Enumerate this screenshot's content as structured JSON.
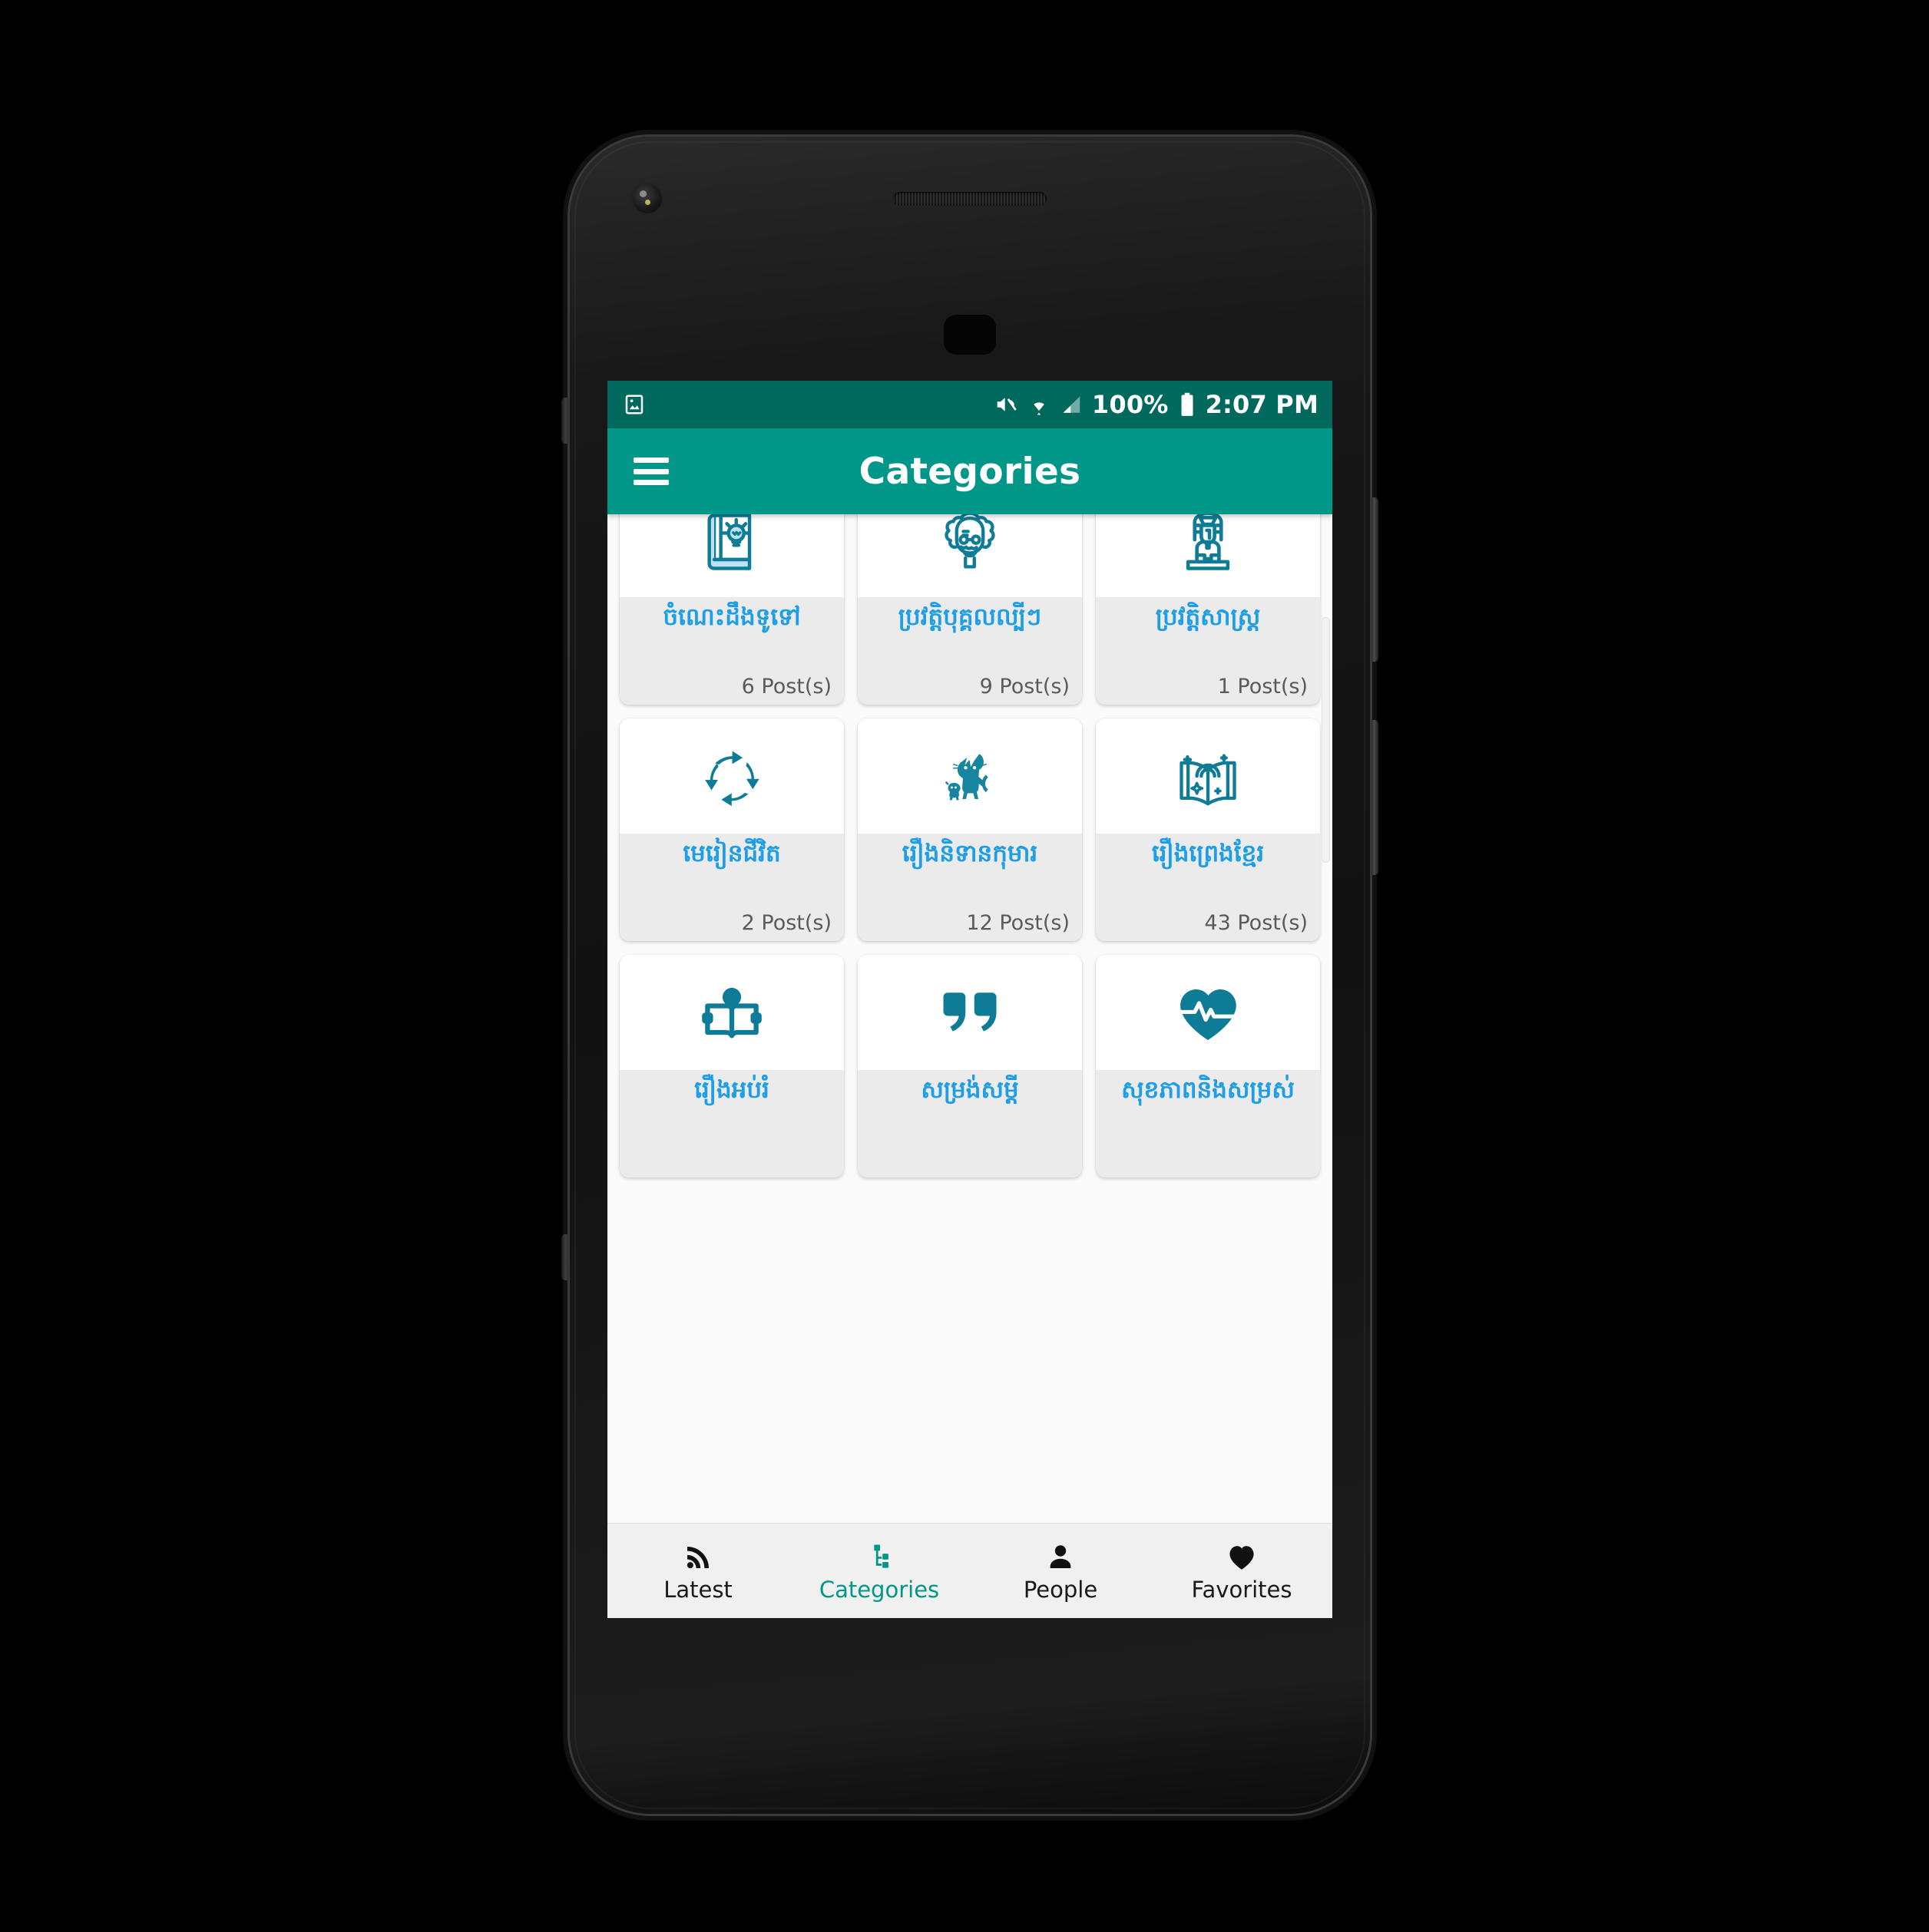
{
  "status_bar": {
    "notification_icon": "image-icon",
    "mute_icon": "volume-mute-icon",
    "wifi_icon": "wifi-icon",
    "signal_icon": "cell-signal-icon",
    "battery_percent": "100%",
    "battery_icon": "battery-full-icon",
    "time": "2:07 PM",
    "background_color": "#00695e"
  },
  "app_bar": {
    "menu_icon": "hamburger-menu-icon",
    "title": "Categories",
    "background_color": "#009688",
    "text_color": "#ffffff"
  },
  "grid": {
    "columns": 3,
    "accent_title_color": "#1e9ee6",
    "icon_color": "#0e7c96",
    "card_body_color": "#ebebeb",
    "cards": [
      {
        "icon": "book-lightbulb-icon",
        "title": "ចំណេះដឹងទូទៅ",
        "count": "6 Post(s)"
      },
      {
        "icon": "einstein-face-icon",
        "title": "ប្រវត្តិបុគ្គលល្បីៗ",
        "count": "9 Post(s)"
      },
      {
        "icon": "sphinx-icon",
        "title": "ប្រវត្តិសាស្ត្រ",
        "count": "1 Post(s)"
      },
      {
        "icon": "cycle-arrows-icon",
        "title": "មេរៀនជីវិត",
        "count": "2 Post(s)"
      },
      {
        "icon": "cat-mouse-icon",
        "title": "រឿងនិទានកុមារ",
        "count": "12 Post(s)"
      },
      {
        "icon": "open-book-sparkle-icon",
        "title": "រឿងព្រេងខ្មែរ",
        "count": "43 Post(s)"
      },
      {
        "icon": "person-reading-icon",
        "title": "រឿងអប់រំ",
        "count": ""
      },
      {
        "icon": "quote-marks-icon",
        "title": "សម្រង់សម្តី",
        "count": ""
      },
      {
        "icon": "heart-pulse-icon",
        "title": "សុខភាពនិងសម្រស់",
        "count": ""
      }
    ]
  },
  "bottom_nav": {
    "active_color": "#009688",
    "inactive_color": "#1a1a1a",
    "items": [
      {
        "icon": "rss-icon",
        "label": "Latest",
        "active": false
      },
      {
        "icon": "account-tree-icon",
        "label": "Categories",
        "active": true
      },
      {
        "icon": "person-icon",
        "label": "People",
        "active": false
      },
      {
        "icon": "heart-icon",
        "label": "Favorites",
        "active": false
      }
    ]
  }
}
